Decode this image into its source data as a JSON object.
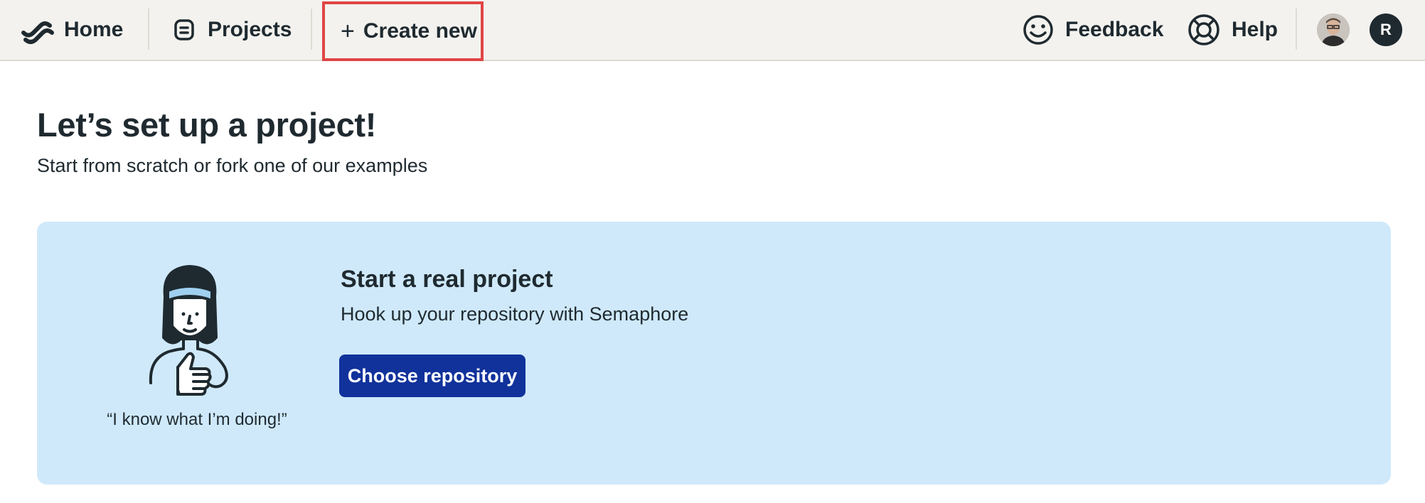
{
  "topbar": {
    "home_label": "Home",
    "projects_label": "Projects",
    "create_plus": "+",
    "create_label": "Create new",
    "feedback_label": "Feedback",
    "help_label": "Help",
    "avatar_initial": "R"
  },
  "icons": {
    "home": "semaphore-logo-icon",
    "projects": "projects-icon",
    "feedback": "smiley-icon",
    "help": "lifebuoy-icon"
  },
  "main": {
    "title": "Let’s set up a project!",
    "subtitle": "Start from scratch or fork one of our examples"
  },
  "card": {
    "quote": "“I know what I’m doing!”",
    "title": "Start a real project",
    "text": "Hook up your repository with Semaphore",
    "button_label": "Choose repository"
  },
  "colors": {
    "topbar_bg": "#f3f2ee",
    "card_bg": "#cfe9fb",
    "button_bg": "#11329b",
    "highlight_border": "#e04545",
    "text": "#1f2a30"
  }
}
